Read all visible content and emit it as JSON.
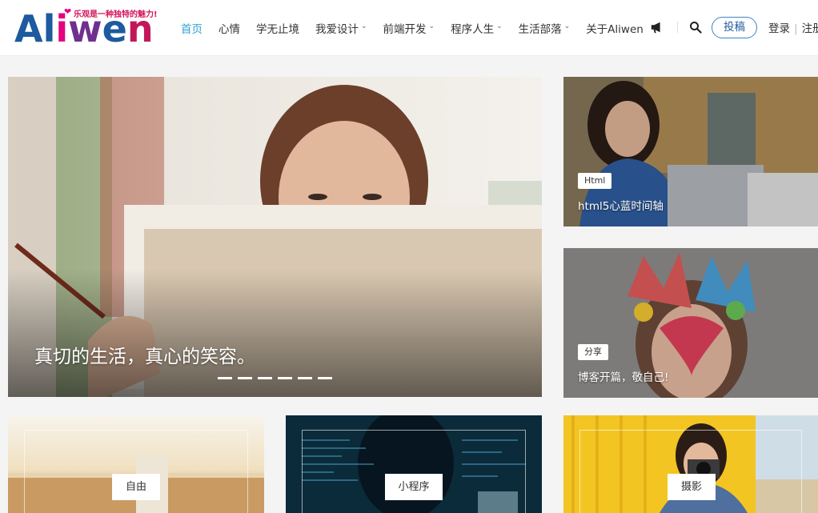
{
  "logo": {
    "text": "Aliwen",
    "slogan": "乐观是一种独特的魅力!"
  },
  "nav": {
    "items": [
      {
        "label": "首页",
        "active": true,
        "dropdown": false
      },
      {
        "label": "心情",
        "active": false,
        "dropdown": false
      },
      {
        "label": "学无止境",
        "active": false,
        "dropdown": false
      },
      {
        "label": "我爱设计",
        "active": false,
        "dropdown": true
      },
      {
        "label": "前端开发",
        "active": false,
        "dropdown": true
      },
      {
        "label": "程序人生",
        "active": false,
        "dropdown": true
      },
      {
        "label": "生活部落",
        "active": false,
        "dropdown": true
      },
      {
        "label": "关于Aliwen",
        "active": false,
        "dropdown": false
      }
    ]
  },
  "header": {
    "submit_label": "投稿",
    "login_label": "登录",
    "register_label": "注册",
    "accent": "#2aa1d3"
  },
  "hero": {
    "title": "真切的生活，真心的笑容。",
    "slide_count": 6
  },
  "side": [
    {
      "tag": "Html",
      "title": "html5心蓝时间轴"
    },
    {
      "tag": "分享",
      "title": "博客开篇，敬自己!"
    }
  ],
  "categories": [
    {
      "label": "自由"
    },
    {
      "label": "小程序"
    },
    {
      "label": "摄影"
    }
  ]
}
